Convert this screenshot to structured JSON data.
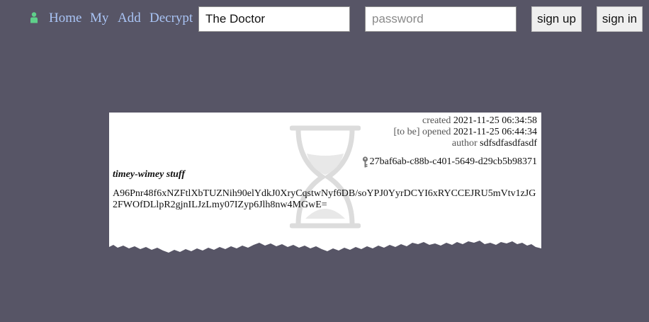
{
  "nav": {
    "links": [
      "Home",
      "My",
      "Add",
      "Decrypt"
    ],
    "username_value": "The Doctor",
    "password_placeholder": "password",
    "signup_label": "sign up",
    "signin_label": "sign in"
  },
  "capsule": {
    "created_label": "created",
    "created_value": "2021-11-25 06:34:58",
    "opened_label": "[to be] opened",
    "opened_value": "2021-11-25 06:44:34",
    "author_label": "author",
    "author_value": "sdfsdfasdfasdf",
    "key_value": "27baf6ab-c88b-c401-5649-d29cb5b98371",
    "title": "timey-wimey stuff",
    "ciphertext": "A96Pnr48f6xNZFtlXbTUZNih90elYdkJ0XryCqstwNyf6DB/soYPJ0YyrDCYI6xRYCCEJRU5mVtv1zJG2FWOfDLlpR2gjnILJzLmy07IZyp6Jlh8nw4MGwE="
  },
  "colors": {
    "background": "#575566",
    "link": "#a9c4f5",
    "user_icon": "#5fd08a"
  }
}
